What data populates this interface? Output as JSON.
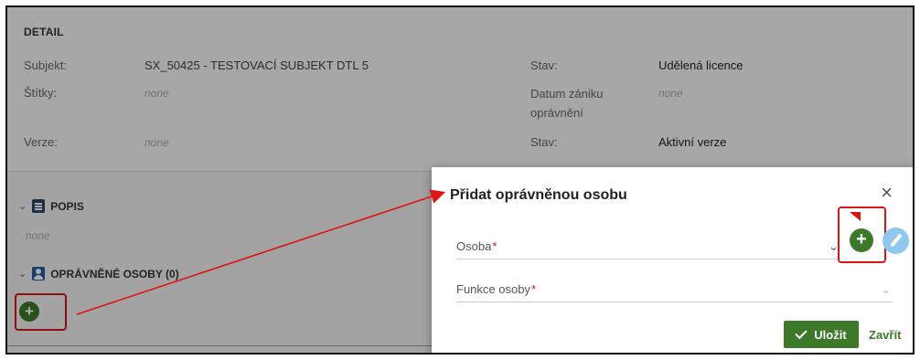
{
  "detail": {
    "title": "DETAIL",
    "subject_label": "Subjekt:",
    "subject_value": "SX_50425 - TESTOVACÍ SUBJEKT DTL 5",
    "tags_label": "Štítky:",
    "tags_value": "none",
    "version_label": "Verze:",
    "version_value": "none",
    "status_label": "Stav:",
    "status_value": "Udělená licence",
    "expiry_label": "Datum zániku oprávnění",
    "expiry_value": "none",
    "status2_label": "Stav:",
    "status2_value": "Aktivní verze"
  },
  "sections": {
    "popis": {
      "label": "POPIS",
      "value": "none"
    },
    "persons": {
      "label": "OPRÁVNĚNÉ OSOBY (0)"
    },
    "add_symbol": "+"
  },
  "modal": {
    "title": "Přidat oprávněnou osobu",
    "close_symbol": "×",
    "person_label": "Osoba",
    "function_label": "Funkce osoby",
    "required_mark": "*",
    "dropdown_arrow": "⌄",
    "add_symbol": "+",
    "save_label": "Uložit",
    "close_label": "Zavřít"
  },
  "colors": {
    "accent_green": "#3c7a2a",
    "highlight_red": "#d91515",
    "edit_blue": "#8ec8ee"
  }
}
